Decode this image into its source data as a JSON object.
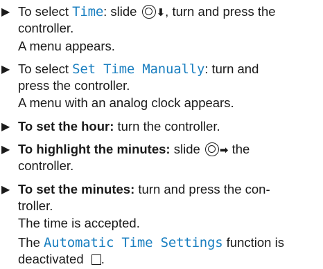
{
  "steps": [
    {
      "lines": [
        {
          "before": "To select ",
          "ui": "Time",
          "after": ": slide ",
          "icon_arrow": "⬇",
          "tail": ", turn and press the"
        },
        {
          "text": "controller."
        },
        {
          "text": "A menu appears."
        }
      ]
    },
    {
      "lines": [
        {
          "before": "To select ",
          "ui": "Set Time Manually",
          "after": ": turn and"
        },
        {
          "text": "press the controller."
        },
        {
          "text": "A menu with an analog clock appears."
        }
      ]
    },
    {
      "lines": [
        {
          "bold": "To set the hour:",
          "after": " turn the controller."
        }
      ]
    },
    {
      "lines": [
        {
          "bold": "To highlight the minutes:",
          "after": " slide ",
          "icon_arrow": "➡",
          "tail": " the"
        },
        {
          "text": "controller."
        }
      ]
    },
    {
      "lines": [
        {
          "bold": "To set the minutes:",
          "after": " turn and press the con-"
        },
        {
          "text": "troller."
        },
        {
          "text": "The time is accepted."
        },
        {
          "before": "The ",
          "ui": "Automatic Time Settings",
          "after": " function is"
        },
        {
          "text": "deactivated ",
          "checkbox": "checkbox-empty-icon",
          "tail": "."
        }
      ]
    }
  ],
  "icons": {
    "bullet": "▶",
    "controller": "controller-icon"
  },
  "colors": {
    "ui_text": "#1a7fc0",
    "body_text": "#1a1a1a"
  }
}
